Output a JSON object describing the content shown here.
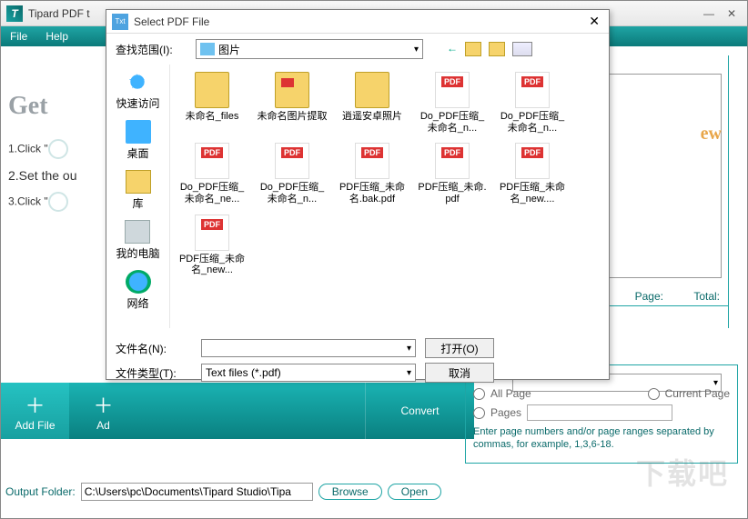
{
  "main": {
    "title": "Tipard PDF t",
    "menu": {
      "file": "File",
      "help": "Help"
    },
    "getstart": "Get",
    "steps": {
      "s1": "1.Click \"",
      "s2": "2.Set the ou",
      "s3": "3.Click \""
    },
    "preview_label": "ew",
    "page_lbl": "Page:",
    "total_lbl": "Total:",
    "toolbar": {
      "addfile": "Add File",
      "addfolder": "Ad",
      "convert": "Convert"
    },
    "output_label": "Output Folder:",
    "output_value": "C:\\Users\\pc\\Documents\\Tipard Studio\\Tipa",
    "browse": "Browse",
    "open": "Open",
    "opt": {
      "all": "All Page",
      "current": "Current Page",
      "pages": "Pages",
      "help": "Enter page numbers and/or page ranges separated by commas, for example, 1,3,6-18."
    },
    "watermark": "下载吧"
  },
  "dialog": {
    "title": "Select PDF File",
    "lookin_label": "查找范围(I):",
    "lookin_value": "图片",
    "places": {
      "quick": "快速访问",
      "desktop": "桌面",
      "lib": "库",
      "pc": "我的电脑",
      "net": "网络"
    },
    "files": [
      {
        "name": "未命名_files",
        "type": "folder"
      },
      {
        "name": "未命名图片提取",
        "type": "folder-red"
      },
      {
        "name": "逍遥安卓照片",
        "type": "folder"
      },
      {
        "name": "Do_PDF压缩_未命名_n...",
        "type": "pdf"
      },
      {
        "name": "Do_PDF压缩_未命名_n...",
        "type": "pdf"
      },
      {
        "name": "Do_PDF压缩_未命名_ne...",
        "type": "pdf"
      },
      {
        "name": "Do_PDF压缩_未命名_n...",
        "type": "pdf"
      },
      {
        "name": "PDF压缩_未命名.bak.pdf",
        "type": "pdf"
      },
      {
        "name": "PDF压缩_未命.pdf",
        "type": "pdf"
      },
      {
        "name": "PDF压缩_未命名_new....",
        "type": "pdf"
      },
      {
        "name": "PDF压缩_未命名_new...",
        "type": "pdf"
      }
    ],
    "filename_label": "文件名(N):",
    "filename_value": "",
    "filetype_label": "文件类型(T):",
    "filetype_value": "Text files (*.pdf)",
    "open": "打开(O)",
    "cancel": "取消"
  }
}
